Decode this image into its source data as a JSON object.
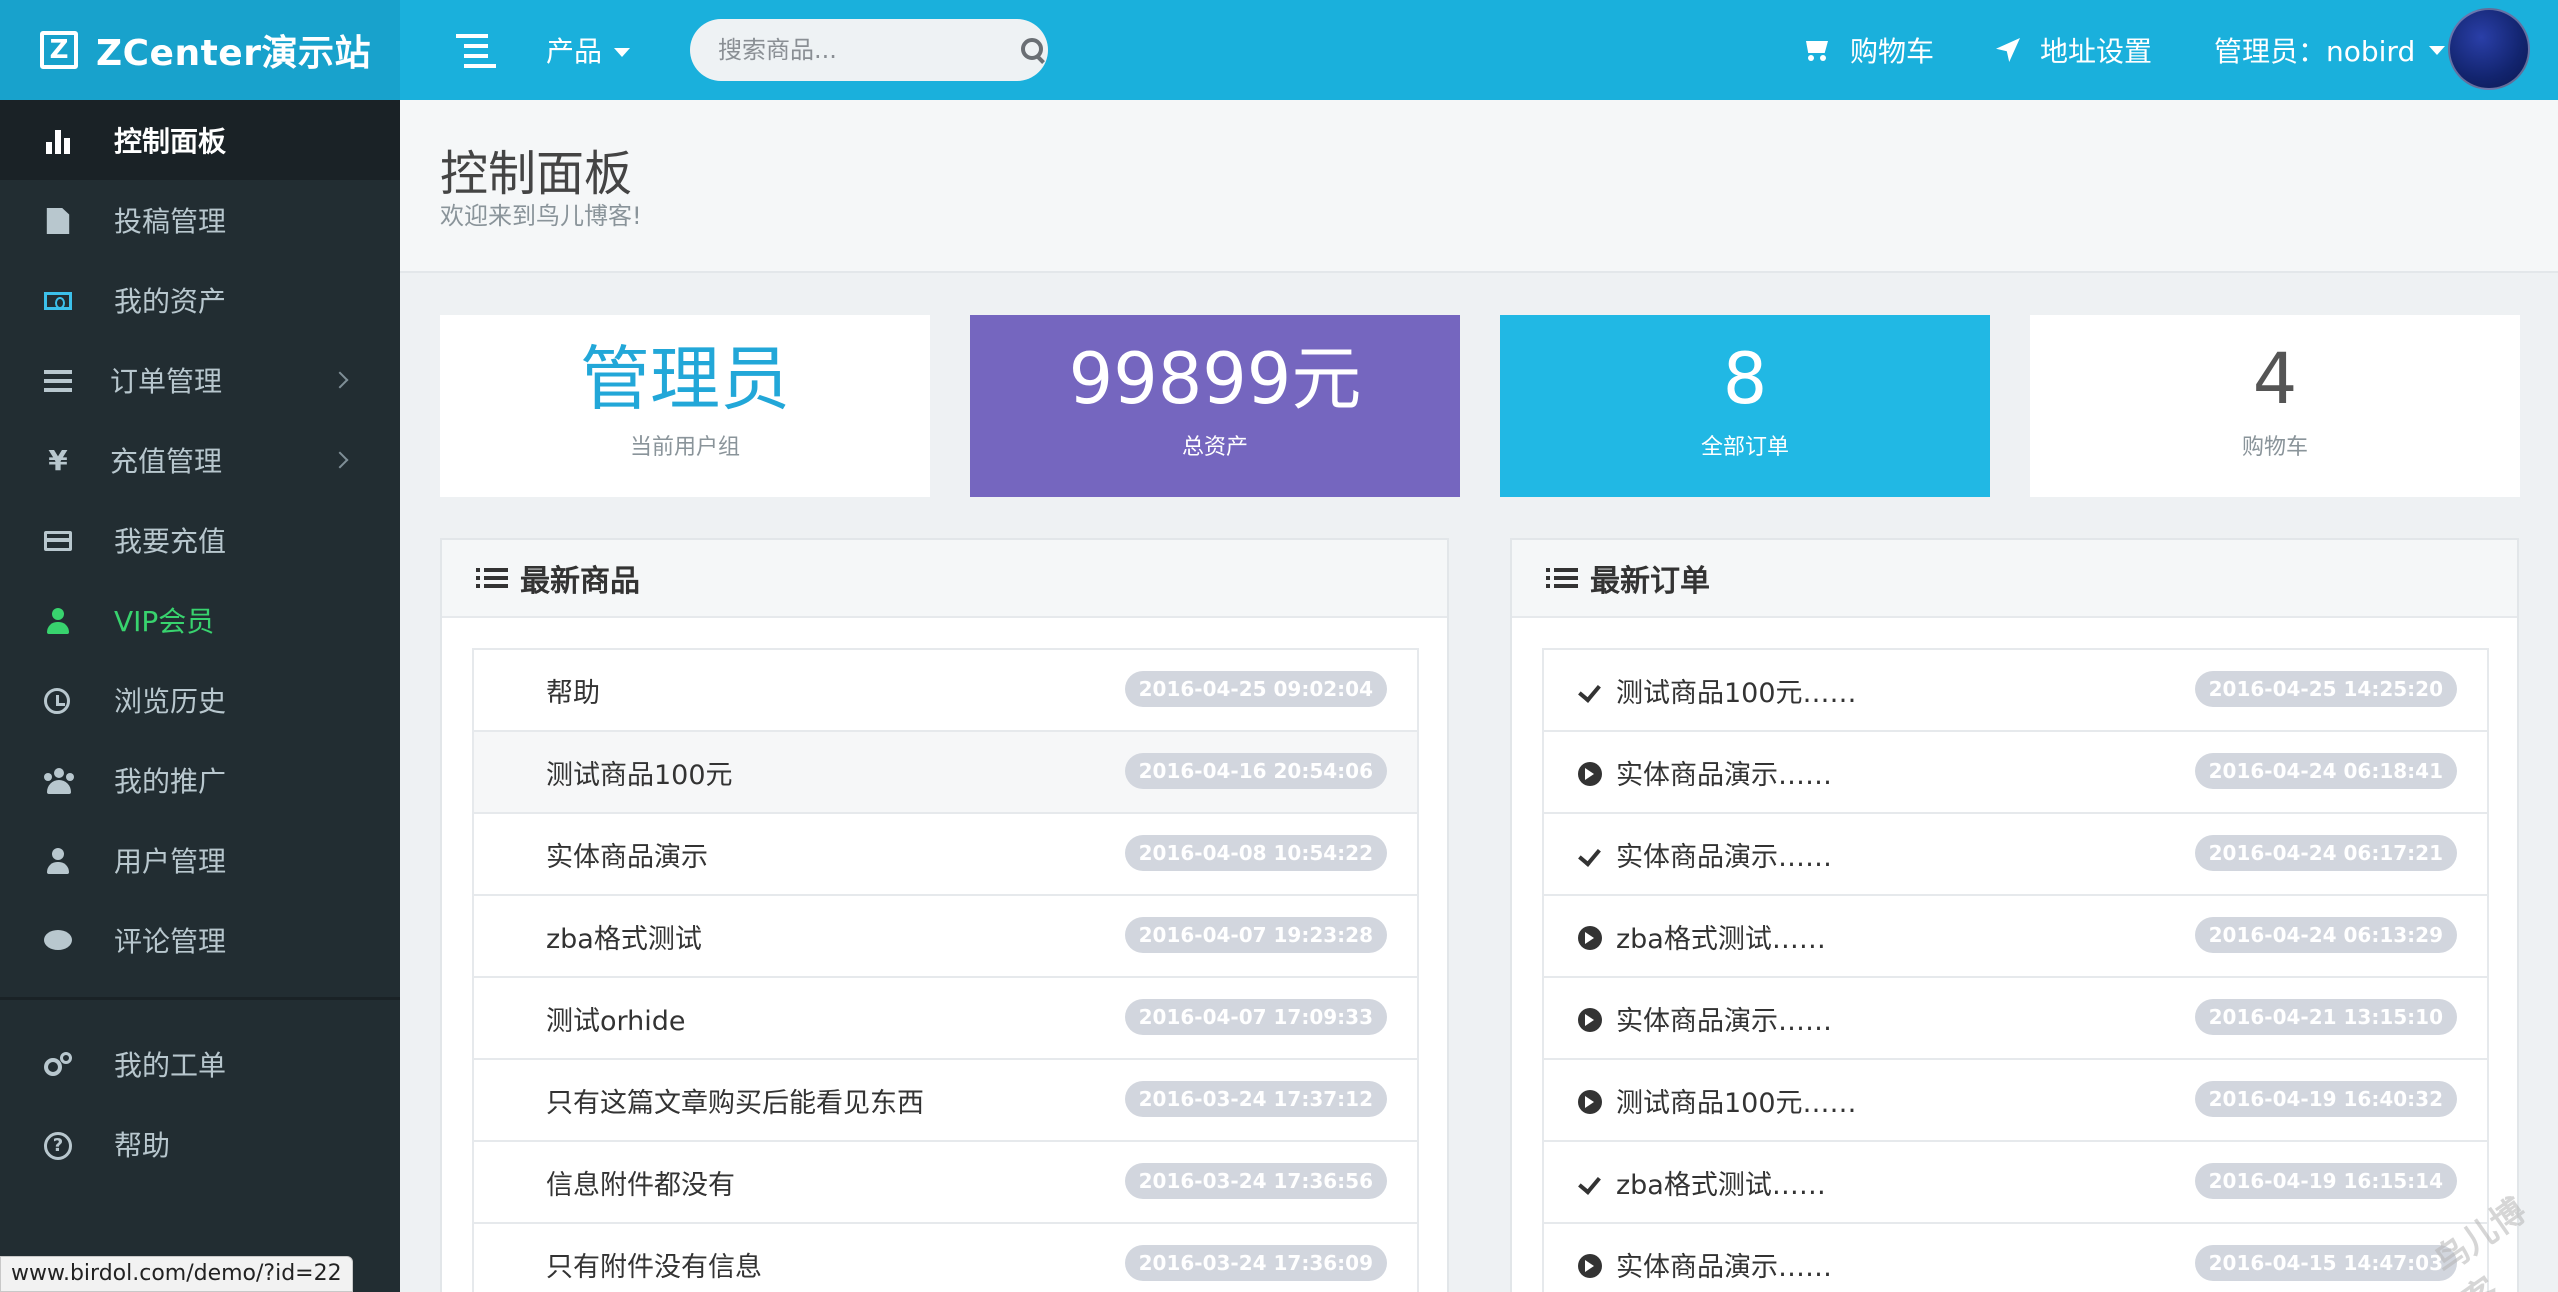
{
  "header": {
    "brand_logo": "Z",
    "brand": "ZCenter演示站",
    "product_menu": "产品",
    "search_placeholder": "搜索商品...",
    "cart": "购物车",
    "address": "地址设置",
    "user": "管理员：nobird"
  },
  "sidebar": {
    "items": [
      {
        "label": "控制面板",
        "icon": "bar-chart-icon"
      },
      {
        "label": "投稿管理",
        "icon": "file-icon"
      },
      {
        "label": "我的资产",
        "icon": "money-icon"
      },
      {
        "label": "订单管理",
        "icon": "list-icon"
      },
      {
        "label": "充值管理",
        "icon": "yen-icon",
        "glyph": "¥"
      },
      {
        "label": "我要充值",
        "icon": "credit-card-icon"
      },
      {
        "label": "VIP会员",
        "icon": "user-icon"
      },
      {
        "label": "浏览历史",
        "icon": "history-icon"
      },
      {
        "label": "我的推广",
        "icon": "users-icon"
      },
      {
        "label": "用户管理",
        "icon": "user-icon"
      },
      {
        "label": "评论管理",
        "icon": "comment-icon"
      },
      {
        "label": "我的工单",
        "icon": "cogs-icon"
      },
      {
        "label": "帮助",
        "icon": "question-icon",
        "glyph": "?"
      }
    ]
  },
  "page": {
    "title": "控制面板",
    "subtitle": "欢迎来到鸟儿博客!"
  },
  "stats": [
    {
      "value": "管理员",
      "label": "当前用户组"
    },
    {
      "value": "99899元",
      "label": "总资产"
    },
    {
      "value": "8",
      "label": "全部订单"
    },
    {
      "value": "4",
      "label": "购物车"
    }
  ],
  "products": {
    "title": "最新商品",
    "rows": [
      {
        "name": "帮助",
        "date": "2016-04-25 09:02:04"
      },
      {
        "name": "测试商品100元",
        "date": "2016-04-16 20:54:06"
      },
      {
        "name": "实体商品演示",
        "date": "2016-04-08 10:54:22"
      },
      {
        "name": "zba格式测试",
        "date": "2016-04-07 19:23:28"
      },
      {
        "name": "测试orhide",
        "date": "2016-04-07 17:09:33"
      },
      {
        "name": "只有这篇文章购买后能看见东西",
        "date": "2016-03-24 17:37:12"
      },
      {
        "name": "信息附件都没有",
        "date": "2016-03-24 17:36:56"
      },
      {
        "name": "只有附件没有信息",
        "date": "2016-03-24 17:36:09"
      }
    ]
  },
  "orders": {
    "title": "最新订单",
    "rows": [
      {
        "name": "测试商品100元……",
        "date": "2016-04-25 14:25:20",
        "icon": "check-icon"
      },
      {
        "name": "实体商品演示……",
        "date": "2016-04-24 06:18:41",
        "icon": "arrow-circle-icon"
      },
      {
        "name": "实体商品演示……",
        "date": "2016-04-24 06:17:21",
        "icon": "check-icon"
      },
      {
        "name": "zba格式测试……",
        "date": "2016-04-24 06:13:29",
        "icon": "arrow-circle-icon"
      },
      {
        "name": "实体商品演示……",
        "date": "2016-04-21 13:15:10",
        "icon": "arrow-circle-icon"
      },
      {
        "name": "测试商品100元……",
        "date": "2016-04-19 16:40:32",
        "icon": "arrow-circle-icon"
      },
      {
        "name": "zba格式测试……",
        "date": "2016-04-19 16:15:14",
        "icon": "check-icon"
      },
      {
        "name": "实体商品演示……",
        "date": "2016-04-15 14:47:03",
        "icon": "arrow-circle-icon"
      }
    ]
  },
  "statusbar": "www.birdol.com/demo/?id=22",
  "watermark": "鸟儿博客",
  "colors": {
    "header": "#1ab0dc",
    "sidebar": "#222d32",
    "vip": "#38d36e",
    "stat_purple": "#7566bf",
    "stat_blue": "#21b8e4",
    "badge": "#d2d6de"
  }
}
